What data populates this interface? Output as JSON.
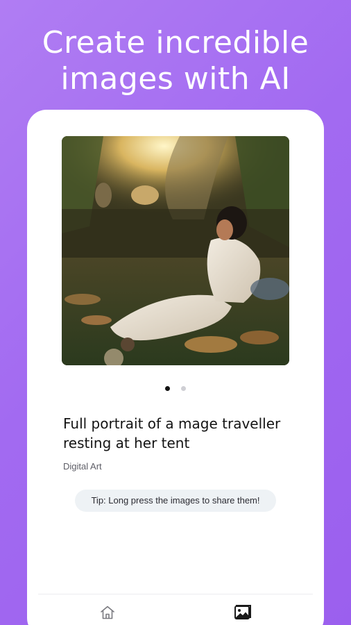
{
  "header": {
    "line1": "Create incredible",
    "line2": "images with AI"
  },
  "carousel": {
    "slide_count": 2,
    "active_index": 0
  },
  "artwork": {
    "title": "Full portrait of a mage traveller resting at her tent",
    "category": "Digital Art"
  },
  "tip": "Tip: Long press the images to share them!",
  "bottom_nav": {
    "items": [
      {
        "icon": "home-icon",
        "active": false
      },
      {
        "icon": "gallery-icon",
        "active": true
      }
    ]
  },
  "colors": {
    "background": "#a26af1",
    "card": "#ffffff",
    "tip_background": "#eef2f5",
    "active_dot": "#111111",
    "inactive_dot": "#cfcfd4"
  }
}
